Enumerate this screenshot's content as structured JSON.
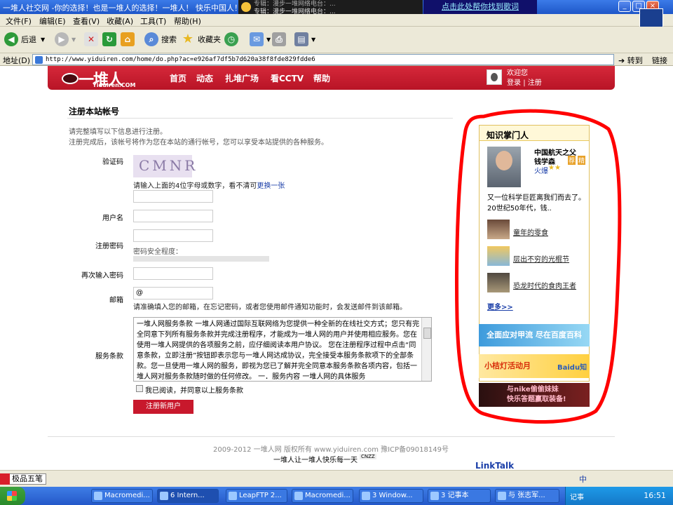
{
  "window": {
    "title": "一堆人社交网 -你的选择！也是一堆人的选择！一堆人！ 快乐中国人！",
    "media_line1": "专辑：漫步一堆网络电台：...",
    "media_line2": "专辑：漫步一堆网络电台：...",
    "help_link": "点击此处帮你找到歌词"
  },
  "menu": [
    "文件(F)",
    "编辑(E)",
    "查看(V)",
    "收藏(A)",
    "工具(T)",
    "帮助(H)"
  ],
  "toolbar": {
    "back": "后退",
    "search": "搜索",
    "favorites": "收藏夹"
  },
  "address": {
    "label": "地址(D)",
    "url": "http://www.yiduiren.com/home/do.php?ac=e926af7df5b7d620a38f8fde829fdde6",
    "go": "转到",
    "links": "链接"
  },
  "header": {
    "logo_cn": "一堆人",
    "logo_en": "Yiduiren.COM",
    "nav": [
      "首页",
      "动态",
      "扎堆广场",
      "看CCTV",
      "帮助"
    ],
    "welcome": "欢迎您",
    "login": "登录",
    "register": "注册",
    "sep": "|"
  },
  "form": {
    "title": "注册本站帐号",
    "intro1": "请完整填写以下信息进行注册。",
    "intro2": "注册完成后，该帐号将作为您在本站的通行帐号，您可以享受本站提供的各种服务。",
    "captcha_label": "验证码",
    "captcha_text": "CMNR",
    "captcha_hint": "请输入上面的4位字母或数字，看不清可",
    "captcha_refresh": "更换一张",
    "username_label": "用户名",
    "password_label": "注册密码",
    "strength_label": "密码安全程度：",
    "repassword_label": "再次输入密码",
    "email_label": "邮箱",
    "email_value": "@",
    "email_hint": "请准确填入您的邮箱，在忘记密码，或者您使用邮件通知功能时，会发送邮件到该邮箱。",
    "terms_label": "服务条款",
    "terms_text": "一堆人网服务条款 一堆人网通过国际互联网络为您提供一种全新的在线社交方式；您只有完全同意下列所有服务条款并完成注册程序，才能成为一堆人网的用户并使用相应服务。您在使用一堆人网提供的各项服务之前，应仔细阅读本用户协议。 您在注册程序过程中点击“同意条款，立即注册”按钮即表示您与一堆人网达成协议，完全接受本服务条款项下的全部条款。您一旦使用一堆人网的服务，即视为您已了解并完全同意本服务条款各项内容，包括一堆人网对服务条款随时做的任何修改。 一．服务内容 一堆人网的具体服务",
    "agree_label": "我已阅读，并同意以上服务条款",
    "submit": "注册新用户"
  },
  "sidebar": {
    "title": "知识掌门人",
    "name1": "中国航天之父",
    "name2": "钱学森",
    "tag1": "荐",
    "tag2": "精",
    "fire": "火爆",
    "stars": "★★",
    "desc": "又一位科学巨匠离我们而去了。20世纪50年代，钱..",
    "links": [
      "童年的零食",
      "层出不穷的光棍节",
      "恐龙时代的食肉王者"
    ],
    "more": "更多>>"
  },
  "ads": {
    "ad1": "全面应对甲流 尽在百度百科",
    "ad2": "小桔灯活动月",
    "ad2_brand": "Baidu知道",
    "ad3_line1": "与nike偷偷妹妹",
    "ad3_line2": "快乐答题赢取装备!"
  },
  "footer": {
    "copyright": "2009-2012 一堆人网 版权所有 www.yiduiren.com 豫ICP备09018149号",
    "slogan": "一堆人让一堆人快乐每一天",
    "cnzz": "CNZZ",
    "linktalk": "LinkTalk"
  },
  "status": {
    "ime": "极品五笔",
    "tray_text": "中"
  },
  "taskbar": {
    "items": [
      "Macromedi...",
      "6 Intern...",
      "LeapFTP 2...",
      "Macromedi...",
      "3 Window...",
      "3 记事本",
      "与 张志军..."
    ],
    "tray_label": "记事",
    "clock": "16:51"
  }
}
